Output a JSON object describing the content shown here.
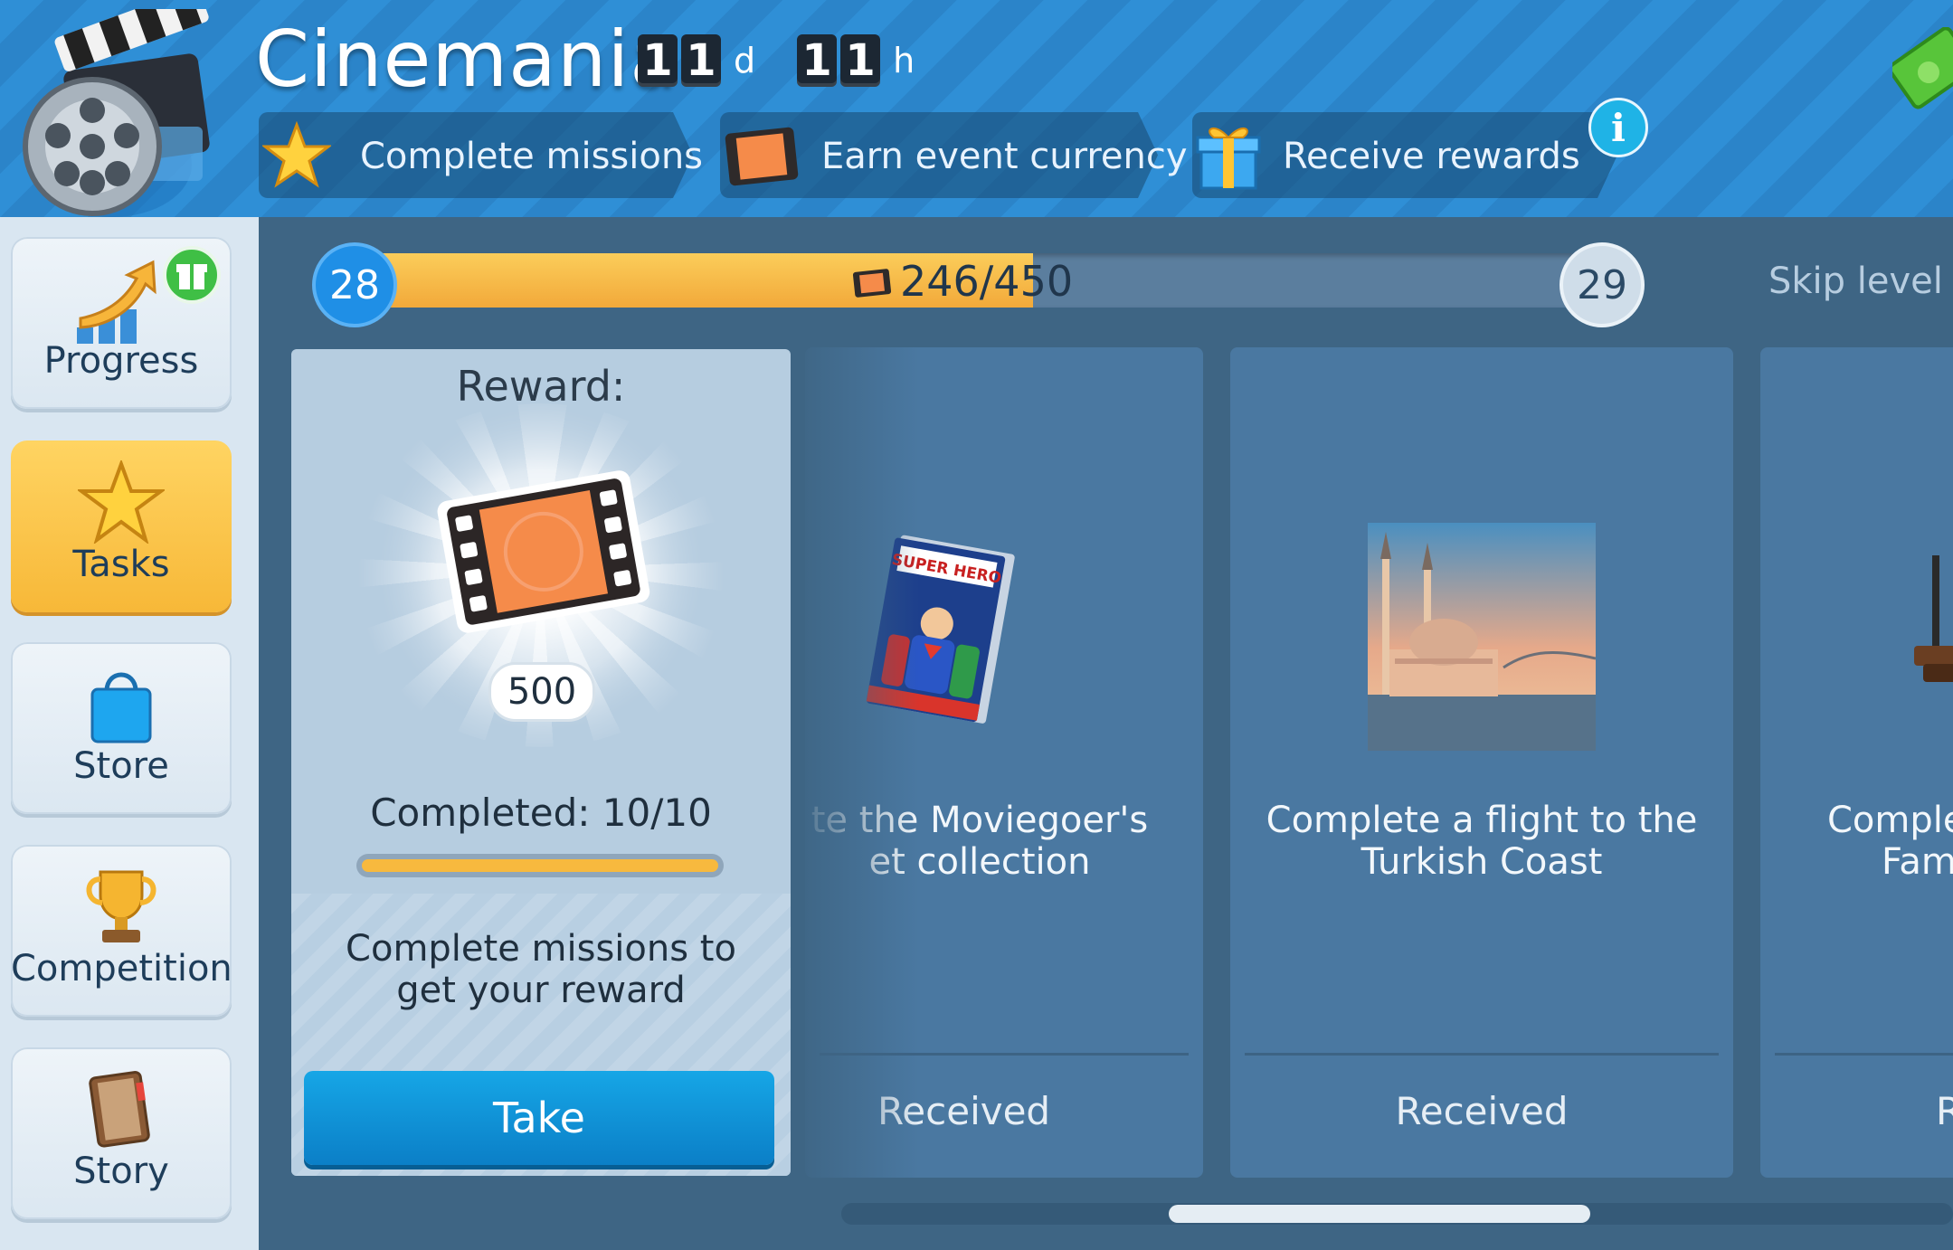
{
  "header": {
    "title": "Cinemania",
    "timer": {
      "days": [
        "1",
        "1"
      ],
      "days_unit": "d",
      "hours": [
        "1",
        "1"
      ],
      "hours_unit": "h"
    },
    "steps": [
      {
        "label": "Complete missions",
        "icon": "star-icon"
      },
      {
        "label": "Earn event currency",
        "icon": "film-ticket-icon"
      },
      {
        "label": "Receive rewards",
        "icon": "gift-icon"
      }
    ],
    "info_label": "i"
  },
  "sidebar": {
    "items": [
      {
        "label": "Progress",
        "icon": "progress-arrow-icon",
        "badge": "gift-badge-icon"
      },
      {
        "label": "Tasks",
        "icon": "star-icon",
        "active": true
      },
      {
        "label": "Store",
        "icon": "shopping-bag-icon"
      },
      {
        "label": "Competition",
        "icon": "trophy-icon"
      },
      {
        "label": "Story",
        "icon": "book-icon"
      }
    ]
  },
  "level": {
    "current": "28",
    "next": "29",
    "progress_text": "246/450",
    "progress_fraction": 0.5467,
    "skip_label": "Skip level"
  },
  "reward": {
    "title": "Reward:",
    "amount": "500",
    "completed": "Completed: 10/10",
    "completed_fraction": 1.0,
    "description": "Complete missions to get your reward",
    "button": "Take"
  },
  "tasks": [
    {
      "title_line1": "te the Moviegoer's",
      "title_line2": "et collection",
      "status": "Received",
      "image": "superhero-comic-book"
    },
    {
      "title_line1": "Complete a flight to the",
      "title_line2": "Turkish Coast",
      "status": "Received",
      "image": "istanbul-mosque-photo"
    },
    {
      "title_line1": "Comple",
      "title_line2": "Fam",
      "status": "R",
      "image": "film-reel-stand"
    }
  ],
  "colors": {
    "accent": "#f7b838",
    "primary_button": "#0b8fd6",
    "header_blue": "#2f8fd6",
    "background": "#3e6584"
  }
}
